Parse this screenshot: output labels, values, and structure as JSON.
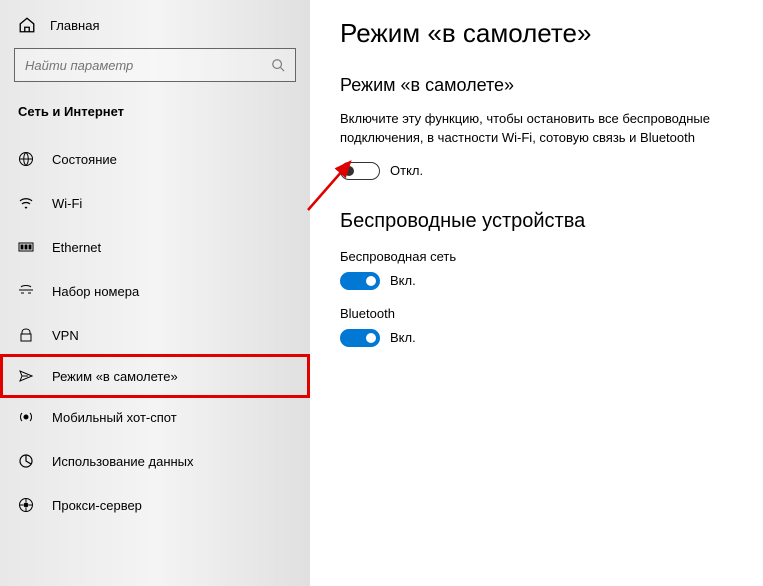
{
  "sidebar": {
    "home": "Главная",
    "search_placeholder": "Найти параметр",
    "category": "Сеть и Интернет",
    "items": [
      {
        "label": "Состояние"
      },
      {
        "label": "Wi-Fi"
      },
      {
        "label": "Ethernet"
      },
      {
        "label": "Набор номера"
      },
      {
        "label": "VPN"
      },
      {
        "label": "Режим «в самолете»"
      },
      {
        "label": "Мобильный хот-спот"
      },
      {
        "label": "Использование данных"
      },
      {
        "label": "Прокси-сервер"
      }
    ]
  },
  "main": {
    "title": "Режим «в самолете»",
    "airplane": {
      "heading": "Режим «в самолете»",
      "desc": "Включите эту функцию, чтобы остановить все беспроводные подключения, в частности Wi-Fi, сотовую связь и Bluetooth",
      "state": "Откл."
    },
    "wireless": {
      "heading": "Беспроводные устройства",
      "wifi_label": "Беспроводная сеть",
      "wifi_state": "Вкл.",
      "bt_label": "Bluetooth",
      "bt_state": "Вкл."
    }
  }
}
